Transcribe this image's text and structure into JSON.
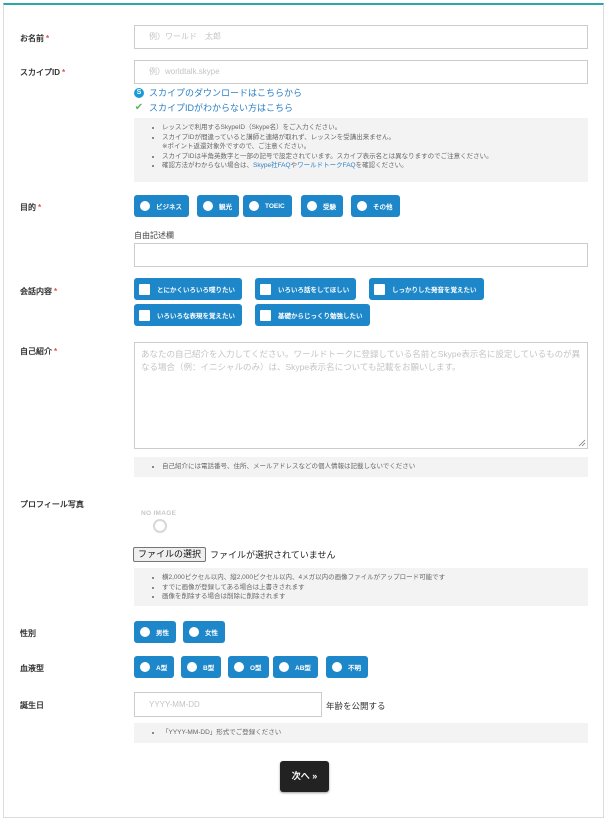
{
  "colors": {
    "accent": "#1d87c9",
    "required": "#d9534f",
    "link": "#2a7fc5",
    "check": "#5cb85c"
  },
  "name": {
    "label": "お名前",
    "required": "*",
    "placeholder": "例）ワールド　太郎"
  },
  "skype": {
    "label": "スカイプID",
    "required": "*",
    "placeholder": "例）worldtalk.skype",
    "download_link": "スカイプのダウンロードはこちらから",
    "unknown_link": "スカイプIDがわからない方はこちら",
    "notes": [
      "レッスンで利用するSkypeID（Skype名）をご入力ください。",
      "スカイプIDが間違っていると講師と連絡が取れず、レッスンを受講出来ません。",
      "※ポイント返還対象外ですので、ご注意ください。",
      "スカイプIDは半角英数字と一部の記号で設定されています。スカイプ表示名とは異なりますのでご注意ください。"
    ],
    "note_last": {
      "prefix": "確認方法がわからない場合は、",
      "link1": "Skype社FAQ",
      "mid": "や",
      "link2": "ワールドトークFAQ",
      "suffix": "を確認ください。"
    }
  },
  "purpose": {
    "label": "目的",
    "required": "*",
    "options": [
      "ビジネス",
      "観光",
      "TOEIC",
      "受験",
      "その他"
    ],
    "free_label": "自由記述欄"
  },
  "conversation": {
    "label": "会話内容",
    "required": "*",
    "options": [
      "とにかくいろいろ喋りたい",
      "いろいろ話をしてほしい",
      "しっかりした発音を覚えたい",
      "いろいろな表現を覚えたい",
      "基礎からじっくり勉強したい"
    ]
  },
  "intro": {
    "label": "自己紹介",
    "required": "*",
    "placeholder": "あなたの自己紹介を入力してください。ワールドトークに登録している名前とSkype表示名に設定しているものが異なる場合（例：イニシャルのみ）は、Skype表示名についても記載をお願いします。",
    "note": "自己紹介には電話番号、住所、メールアドレスなどの個人情報は記載しないでください"
  },
  "photo": {
    "label": "プロフィール写真",
    "noimage": "NO IMAGE",
    "file_button": "ファイルの選択",
    "file_status": "ファイルが選択されていません",
    "notes": [
      "横2,000ピクセル以内、縦2,000ピクセル以内、4メガ以内の画像ファイルがアップロード可能です",
      "すでに画像が登録してある場合は上書きされます",
      "画像を削除する場合は削除に削除されます"
    ]
  },
  "gender": {
    "label": "性別",
    "options": [
      "男性",
      "女性"
    ]
  },
  "blood": {
    "label": "血液型",
    "options": [
      "A型",
      "B型",
      "O型",
      "AB型",
      "不明"
    ]
  },
  "birthday": {
    "label": "誕生日",
    "placeholder": "YYYY-MM-DD",
    "age_public": "年齢を公開する",
    "note": "「YYYY-MM-DD」形式でご登録ください"
  },
  "next_button": "次へ »"
}
